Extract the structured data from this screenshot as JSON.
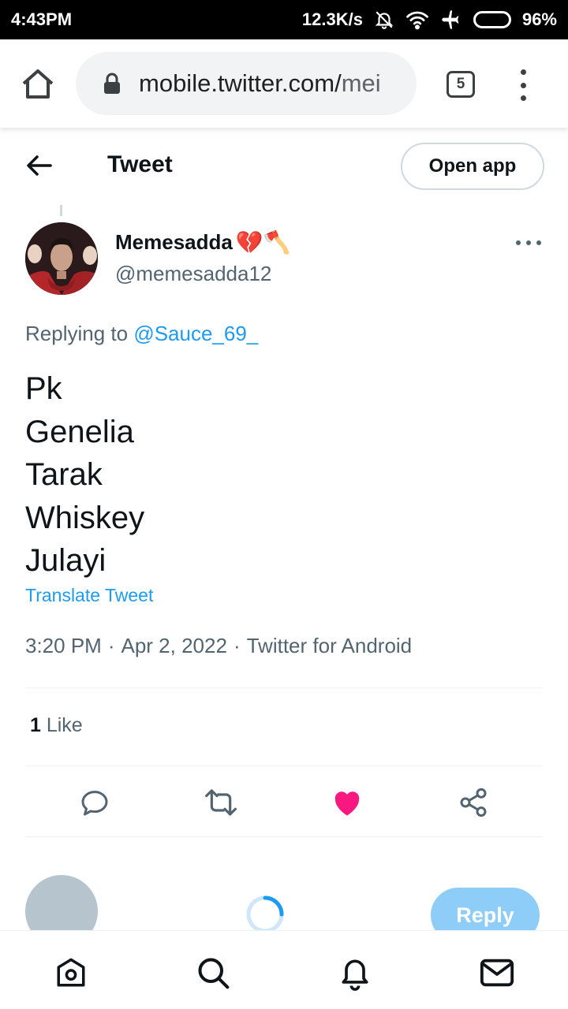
{
  "status_bar": {
    "time": "4:43PM",
    "net_speed": "12.3K/s",
    "battery": "96%",
    "icons": [
      "mute-bell-icon",
      "wifi-icon",
      "airplane-icon",
      "battery-icon"
    ]
  },
  "browser": {
    "url_main": "mobile.twitter.com/",
    "url_rest": "mei",
    "tab_count": "5"
  },
  "header": {
    "title": "Tweet",
    "open_app_label": "Open app"
  },
  "tweet": {
    "author_name": "Memesadda",
    "author_emojis": "💔🪓",
    "author_handle": "@memesadda12",
    "replying_prefix": "Replying to ",
    "replying_to": "@Sauce_69_",
    "lines": [
      "Pk",
      "Genelia",
      "Tarak",
      "Whiskey",
      "Julayi"
    ],
    "translate_label": "Translate Tweet",
    "time": "3:20 PM",
    "sep1": "·",
    "date": "Apr 2, 2022",
    "sep2": "·",
    "source": "Twitter for Android",
    "like_count": "1",
    "like_label": " Like"
  },
  "composer": {
    "reply_label": "Reply"
  },
  "colors": {
    "accent": "#1d9bf0",
    "like": "#f91880",
    "reply_disabled": "#8ecdf8"
  }
}
